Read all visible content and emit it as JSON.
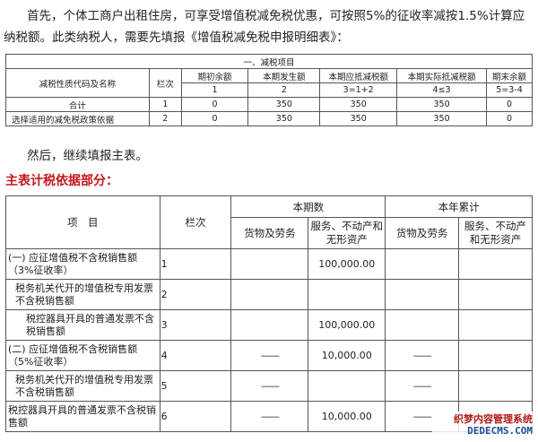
{
  "intro_paragraph": "首先，个体工商户出租住房，可享受增值税减免税优惠，可按照5%的征收率减按1.5%计算应纳税额。此类纳税人，需要先填报《增值税减免税申报明细表》：",
  "table1": {
    "section_title": "一、减税项目",
    "col_name_header": "减税性质代码及名称",
    "col_lan_header": "栏次",
    "col_headers": [
      "期初余额",
      "本期发生额",
      "本期应抵减税额",
      "本期实际抵减税额",
      "期末余额"
    ],
    "col_formulas": [
      "1",
      "2",
      "3=1+2",
      "4≤3",
      "5=3-4"
    ],
    "rows": [
      {
        "name": "合计",
        "lan": "1",
        "values": [
          "0",
          "350",
          "350",
          "350",
          "0"
        ]
      },
      {
        "name": "选择适用的减免税政策依据",
        "lan": "2",
        "values": [
          "0",
          "350",
          "350",
          "350",
          "0"
        ]
      }
    ]
  },
  "then_paragraph": "然后，继续填报主表。",
  "section_heading": "主表计税依据部分：",
  "table2": {
    "item_header": "项　目",
    "lan_header": "栏次",
    "current_period": "本期数",
    "year_cumulative": "本年累计",
    "goods_label": "货物及劳务",
    "services_label": "服务、不动产和无形资产",
    "rows": [
      {
        "item": "(一) 应征增值税不含税销售额（3%征收率）",
        "lan": "1",
        "goods": "",
        "services": "100,000.00",
        "y_goods": "",
        "y_services": ""
      },
      {
        "item": "税务机关代开的增值税专用发票不含税销售额",
        "lan": "2",
        "goods": "",
        "services": "",
        "y_goods": "",
        "y_services": ""
      },
      {
        "item": "税控器具开具的普通发票不含税销售额",
        "lan": "3",
        "goods": "",
        "services": "100,000.00",
        "y_goods": "",
        "y_services": ""
      },
      {
        "item": "(二) 应征增值税不含税销售额（5%征收率）",
        "lan": "4",
        "goods": "——",
        "services": "10,000.00",
        "y_goods": "——",
        "y_services": ""
      },
      {
        "item": "税务机关代开的增值税专用发票不含税销售额",
        "lan": "5",
        "goods": "——",
        "services": "",
        "y_goods": "——",
        "y_services": ""
      },
      {
        "item": "税控器具开具的普通发票不含税销售额",
        "lan": "6",
        "goods": "——",
        "services": "10,000.00",
        "y_goods": "——",
        "y_services": ""
      }
    ]
  },
  "watermark": {
    "line1": "织梦内容管理系统",
    "line2": "DEDECMS.COM"
  }
}
